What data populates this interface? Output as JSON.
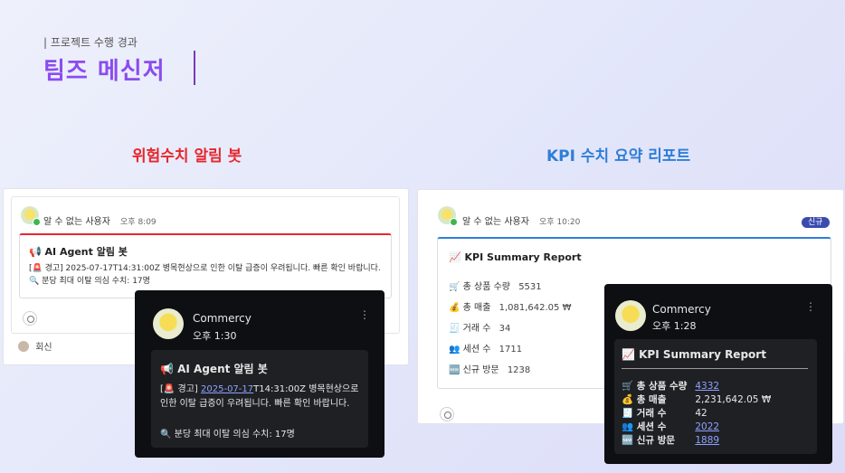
{
  "header": {
    "kicker": "| 프로젝트 수행 경과",
    "title": "팀즈 메신저"
  },
  "left": {
    "section_title": "위험수치 알림 봇",
    "sender": "알 수 없는 사용자",
    "time": "오후 8:09",
    "card_title": "📢 AI Agent 알림 봇",
    "line1": "[🚨 경고] 2025-07-17T14:31:00Z 병목현상으로 인한 이탈 급증이 우려됩니다. 빠른 확인 바랍니다.",
    "line2": "🔍 분당 최대 이탈 의심 수치: 17명",
    "reply": "회신"
  },
  "left_dark": {
    "sender": "Commercy",
    "time": "오후 1:30",
    "card_title": "📢 AI Agent 알림 봇",
    "line1_prefix": "[🚨 경고] ",
    "line1_link": "2025-07-17",
    "line1_rest": "T14:31:00Z 병목현상으로",
    "line2": "인한 이탈 급증이 우려됩니다. 빠른 확인 바랍니다.",
    "line3": "🔍 분당 최대 이탈 의심 수치: 17명"
  },
  "right": {
    "section_title": "KPI 수치 요약 리포트",
    "sender": "알 수 없는 사용자",
    "time": "오후 10:20",
    "badge": "신규",
    "card_title": "📈 KPI Summary Report",
    "rows": [
      {
        "icon": "🛒",
        "label": "총 상품 수량",
        "value": "5531"
      },
      {
        "icon": "💰",
        "label": "총 매출",
        "value": "1,081,642.05 ₩"
      },
      {
        "icon": "🧾",
        "label": "거래 수",
        "value": "34"
      },
      {
        "icon": "👥",
        "label": "세션 수",
        "value": "1711"
      },
      {
        "icon": "🆕",
        "label": "신규 방문",
        "value": "1238"
      }
    ]
  },
  "right_dark": {
    "sender": "Commercy",
    "time": "오후 1:28",
    "card_title": "📈 KPI Summary Report",
    "rows": [
      {
        "icon": "🛒",
        "label": "총 상품 수량",
        "value": "4332"
      },
      {
        "icon": "💰",
        "label": "총 매출",
        "value": "2,231,642.05 ₩"
      },
      {
        "icon": "🧾",
        "label": "거래 수",
        "value": "42"
      },
      {
        "icon": "👥",
        "label": "세션 수",
        "value": "2022"
      },
      {
        "icon": "🆕",
        "label": "신규 방문",
        "value": "1889"
      }
    ]
  }
}
